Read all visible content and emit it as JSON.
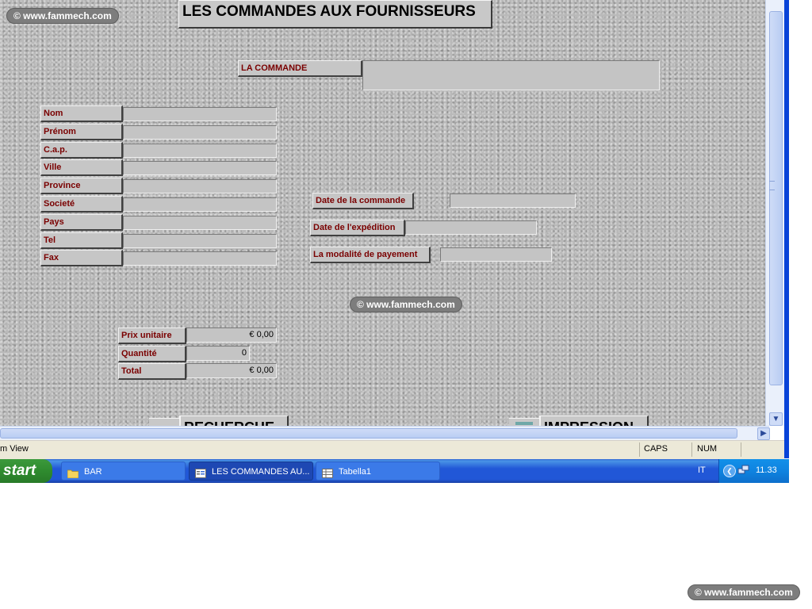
{
  "watermark": "© www.fammech.com",
  "form": {
    "title": "LES COMMANDES AUX FOURNISSEURS",
    "order_label": "LA COMMANDE",
    "order_value": "",
    "contact_fields": [
      {
        "label": "Nom",
        "value": ""
      },
      {
        "label": "Prénom",
        "value": ""
      },
      {
        "label": "C.a.p.",
        "value": ""
      },
      {
        "label": "Ville",
        "value": ""
      },
      {
        "label": "Province",
        "value": ""
      },
      {
        "label": "Societé",
        "value": ""
      },
      {
        "label": "Pays",
        "value": ""
      },
      {
        "label": "Tel",
        "value": ""
      },
      {
        "label": "Fax",
        "value": ""
      }
    ],
    "dates": [
      {
        "label": "Date de la commande",
        "value": ""
      },
      {
        "label": "Date de l'expédition",
        "value": ""
      },
      {
        "label": "La modalité de payement",
        "value": ""
      }
    ],
    "prix_label": "Prix unitaire",
    "prix_value": "€ 0,00",
    "quantite_label": "Quantité",
    "quantite_value": "0",
    "total_label": "Total",
    "total_value": "€ 0,00",
    "recherche_button": "RECHERCHE",
    "impression_button": "IMPRESSION"
  },
  "statusbar": {
    "view": "m View",
    "caps": "CAPS",
    "num": "NUM"
  },
  "taskbar": {
    "start": "start",
    "tasks": [
      {
        "label": "BAR",
        "icon": "folder-icon",
        "active": false
      },
      {
        "label": "LES COMMANDES AU...",
        "icon": "form-icon",
        "active": true
      },
      {
        "label": "Tabella1",
        "icon": "table-icon",
        "active": false
      }
    ],
    "language": "IT",
    "clock": "11.33"
  },
  "colors": {
    "label_text": "#7a0000",
    "taskbar_blue": "#2157d7",
    "start_green": "#2f8b2f"
  }
}
